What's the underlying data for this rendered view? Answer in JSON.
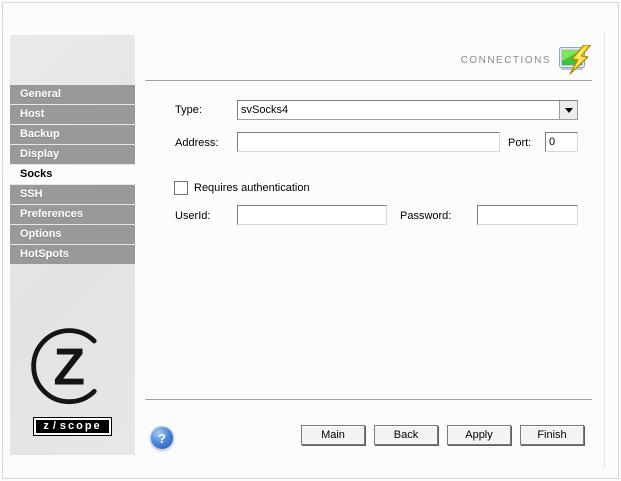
{
  "header": {
    "title": "CONNECTIONS",
    "icon": "display-lightning-icon"
  },
  "sidebar": {
    "items": [
      {
        "label": "General",
        "selected": false
      },
      {
        "label": "Host",
        "selected": false
      },
      {
        "label": "Backup",
        "selected": false
      },
      {
        "label": "Display",
        "selected": false
      },
      {
        "label": "Socks",
        "selected": true
      },
      {
        "label": "SSH",
        "selected": false
      },
      {
        "label": "Preferences",
        "selected": false
      },
      {
        "label": "Options",
        "selected": false
      },
      {
        "label": "HotSpots",
        "selected": false
      }
    ],
    "logo": {
      "letter": "Z",
      "brand_left": "z",
      "brand_slash": "/",
      "brand_right": "scope"
    }
  },
  "form": {
    "type": {
      "label": "Type:",
      "value": "svSocks4"
    },
    "address": {
      "label": "Address:",
      "value": ""
    },
    "port": {
      "label": "Port:",
      "value": "0"
    },
    "requires_auth": {
      "label": "Requires authentication",
      "checked": false
    },
    "userid": {
      "label": "UserId:",
      "value": ""
    },
    "password": {
      "label": "Password:",
      "value": ""
    }
  },
  "footer": {
    "help_label": "?",
    "buttons": [
      {
        "label": "Main"
      },
      {
        "label": "Back"
      },
      {
        "label": "Apply"
      },
      {
        "label": "Finish"
      }
    ]
  },
  "colors": {
    "sidebar_item": "#9b9899",
    "sidebar_panel": "#e6e4e5",
    "divider": "#a3a3a3",
    "title_text": "#8a8a8a",
    "screen_green": "#3ec43e",
    "bolt_yellow": "#ffd829",
    "help_blue": "#2f6cc4"
  }
}
